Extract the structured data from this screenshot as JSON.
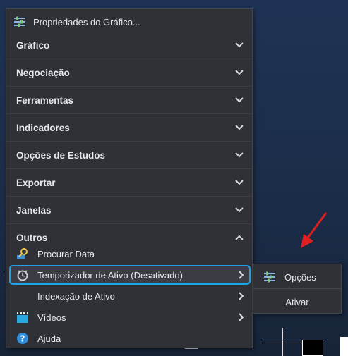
{
  "menu": {
    "properties_label": "Propriedades do Gráfico...",
    "sections": [
      {
        "label": "Gráfico",
        "expanded": false
      },
      {
        "label": "Negociação",
        "expanded": false
      },
      {
        "label": "Ferramentas",
        "expanded": false
      },
      {
        "label": "Indicadores",
        "expanded": false
      },
      {
        "label": "Opções de Estudos",
        "expanded": false
      },
      {
        "label": "Exportar",
        "expanded": false
      },
      {
        "label": "Janelas",
        "expanded": false
      },
      {
        "label": "Outros",
        "expanded": true
      }
    ],
    "items": [
      {
        "label": "Procurar Data",
        "icon": "search-data-icon",
        "has_submenu": false
      },
      {
        "label": "Temporizador de Ativo (Desativado)",
        "icon": "timer-icon",
        "has_submenu": true,
        "highlighted": true
      },
      {
        "label": "Indexação de Ativo",
        "icon": "",
        "has_submenu": true
      },
      {
        "label": "Vídeos",
        "icon": "video-icon",
        "has_submenu": true
      },
      {
        "label": "Ajuda",
        "icon": "help-icon",
        "has_submenu": false
      }
    ]
  },
  "submenu": {
    "options_label": "Opções",
    "activate_label": "Ativar"
  },
  "colors": {
    "highlight_border": "#1fa4e3",
    "menu_background": "#2f3137",
    "annotation_arrow": "#e02020"
  }
}
